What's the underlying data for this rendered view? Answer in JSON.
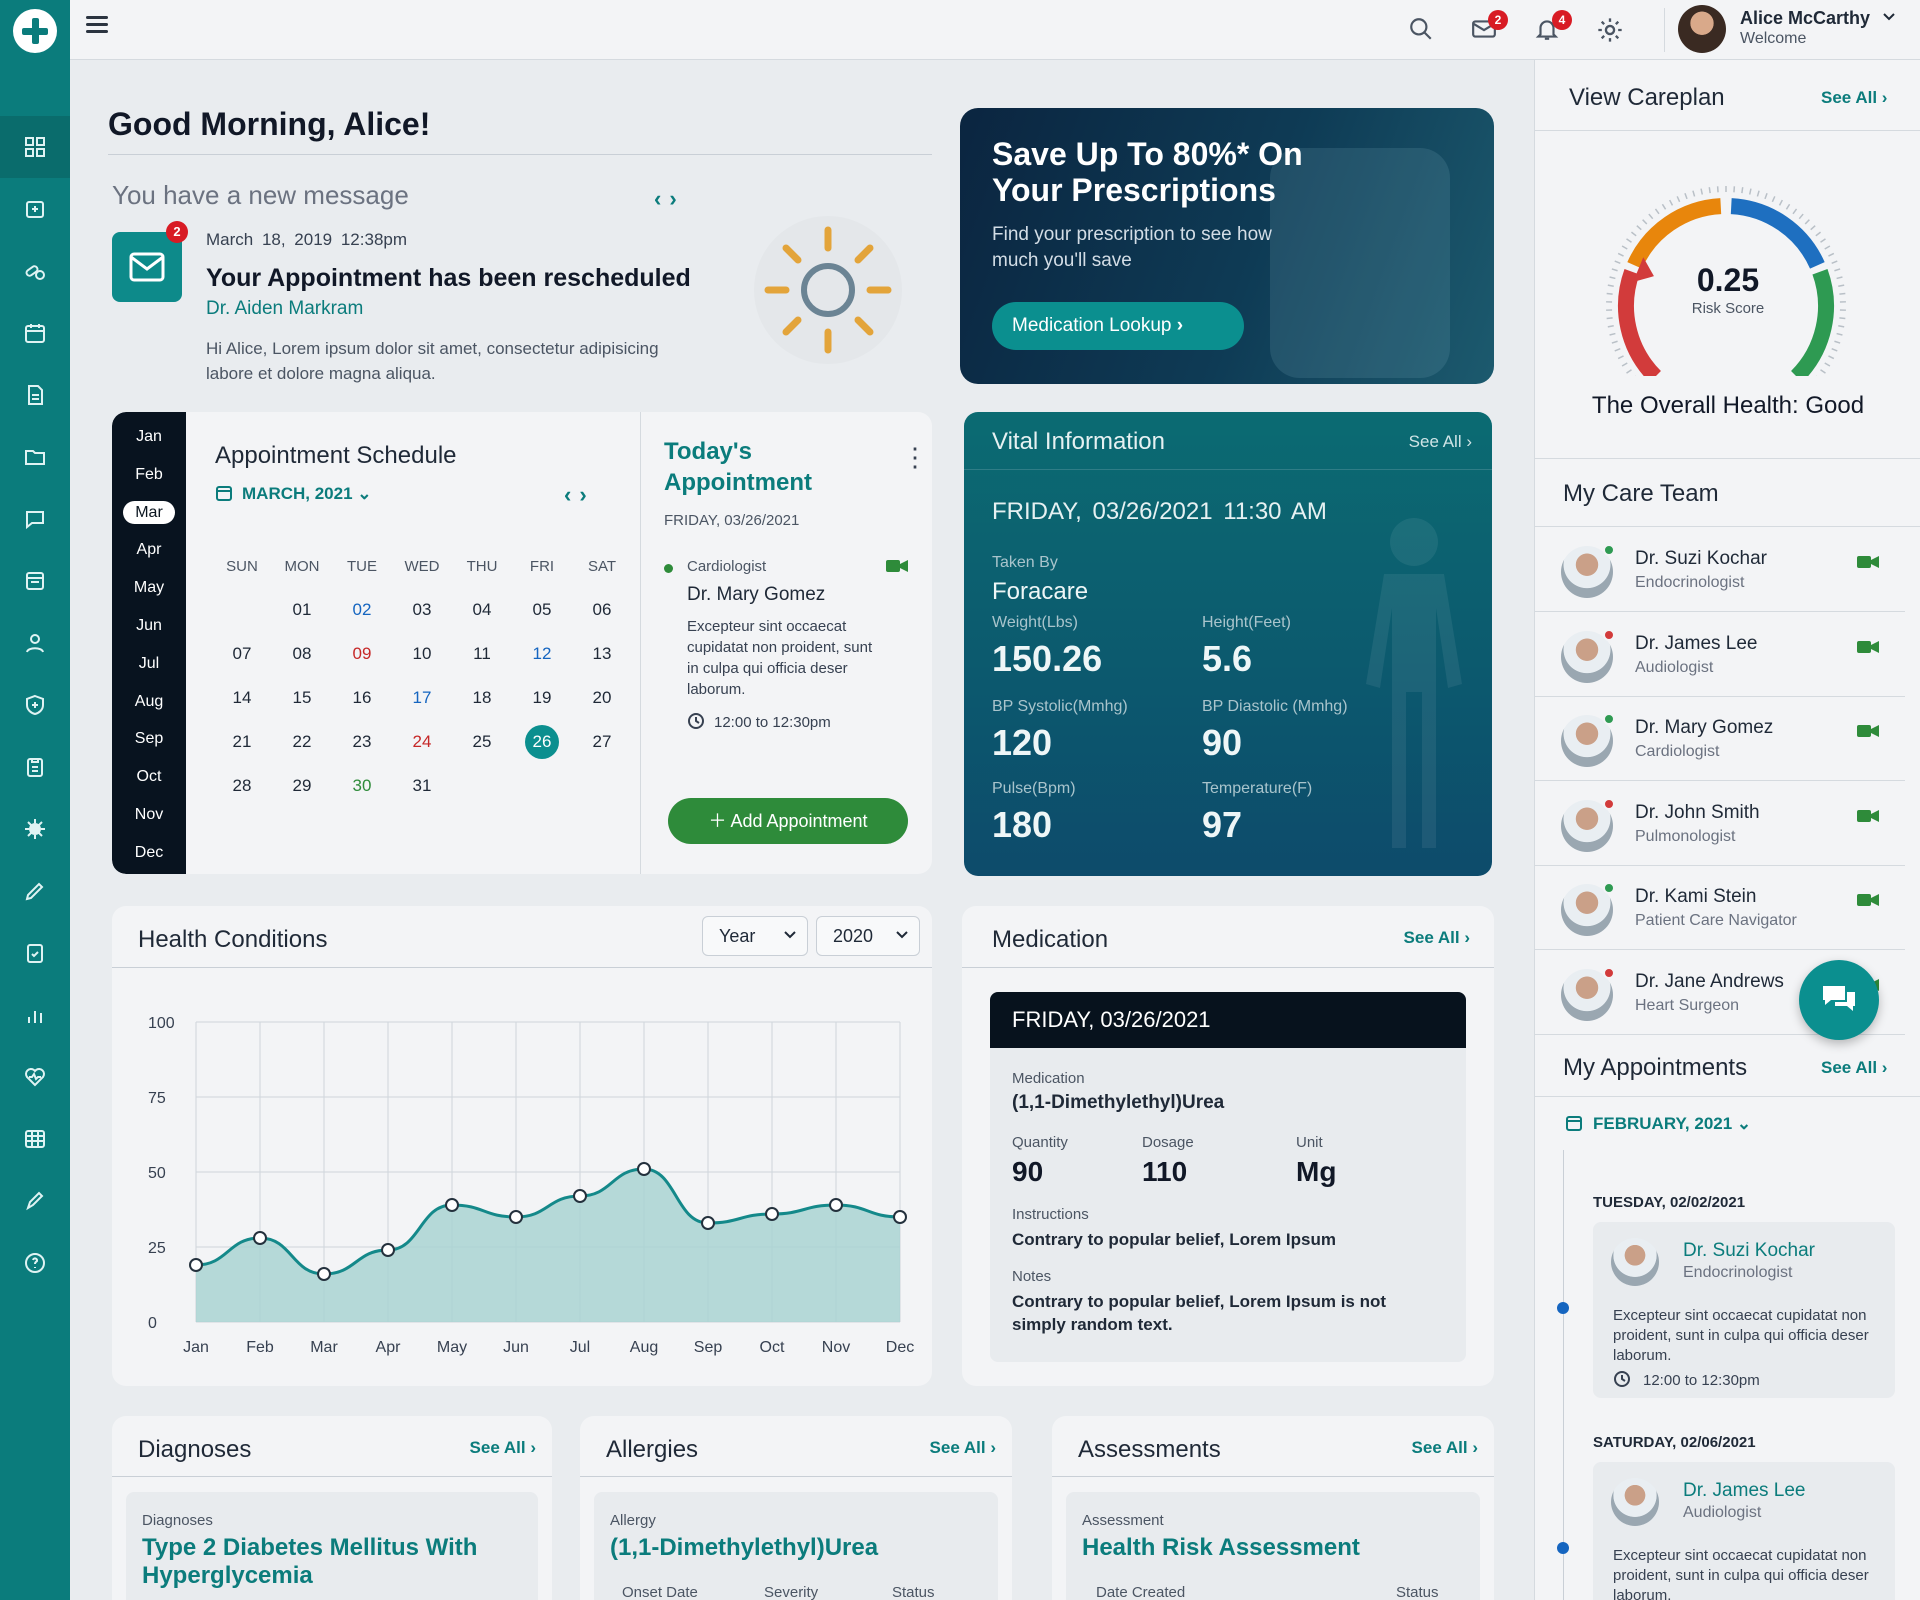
{
  "header": {
    "user_name": "Alice McCarthy",
    "user_sub": "Welcome",
    "mail_badge": "2",
    "bell_badge": "4"
  },
  "greeting": {
    "title": "Good Morning, Alice!",
    "new_message": "You have a new message",
    "msg_badge": "2",
    "msg_date": "March 18, 2019 12:38pm",
    "msg_title": "Your Appointment has been rescheduled",
    "msg_from": "Dr. Aiden Markram",
    "msg_body": "Hi Alice, Lorem ipsum dolor sit amet, consectetur adipisicing labore et dolore magna aliqua."
  },
  "promo": {
    "title": "Save Up To 80%* On Your Prescriptions",
    "subtitle": "Find your prescription to see how much you'll save",
    "button": "Medication Lookup"
  },
  "schedule": {
    "months": [
      "Jan",
      "Feb",
      "Mar",
      "Apr",
      "May",
      "Jun",
      "Jul",
      "Aug",
      "Sep",
      "Oct",
      "Nov",
      "Dec"
    ],
    "active_month_index": 2,
    "title": "Appointment Schedule",
    "month_label": "MARCH, 2021",
    "weekdays": [
      "SUN",
      "MON",
      "TUE",
      "WED",
      "THU",
      "FRI",
      "SAT"
    ],
    "weeks": [
      [
        {
          "d": ""
        },
        {
          "d": "01"
        },
        {
          "d": "02",
          "c": "blue"
        },
        {
          "d": "03"
        },
        {
          "d": "04"
        },
        {
          "d": "05"
        },
        {
          "d": "06"
        }
      ],
      [
        {
          "d": "07"
        },
        {
          "d": "08"
        },
        {
          "d": "09",
          "c": "red"
        },
        {
          "d": "10"
        },
        {
          "d": "11"
        },
        {
          "d": "12",
          "c": "blue"
        },
        {
          "d": "13"
        }
      ],
      [
        {
          "d": "14"
        },
        {
          "d": "15"
        },
        {
          "d": "16"
        },
        {
          "d": "17",
          "c": "blue"
        },
        {
          "d": "18"
        },
        {
          "d": "19"
        },
        {
          "d": "20"
        }
      ],
      [
        {
          "d": "21"
        },
        {
          "d": "22"
        },
        {
          "d": "23"
        },
        {
          "d": "24",
          "c": "red"
        },
        {
          "d": "25"
        },
        {
          "d": "26",
          "c": "today"
        },
        {
          "d": "27"
        }
      ],
      [
        {
          "d": "28"
        },
        {
          "d": "29"
        },
        {
          "d": "30",
          "c": "green"
        },
        {
          "d": "31"
        },
        {
          "d": ""
        },
        {
          "d": ""
        },
        {
          "d": ""
        }
      ]
    ]
  },
  "today": {
    "title": "Today's Appointment",
    "date": "FRIDAY, 03/26/2021",
    "specialty": "Cardiologist",
    "doctor": "Dr. Mary Gomez",
    "description": "Excepteur sint occaecat cupidatat non proident, sunt in culpa qui officia deser laborum.",
    "time": "12:00 to 12:30pm",
    "add_button": "Add Appointment"
  },
  "vital": {
    "title": "Vital Information",
    "see_all": "See All",
    "date": "FRIDAY, 03/26/2021 11:30 AM",
    "taken_by_label": "Taken By",
    "taken_by": "Foracare",
    "weight_label": "Weight(Lbs)",
    "weight": "150.26",
    "height_label": "Height(Feet)",
    "height": "5.6",
    "bps_label": "BP Systolic(Mmhg)",
    "bps": "120",
    "bpd_label": "BP Diastolic (Mmhg)",
    "bpd": "90",
    "pulse_label": "Pulse(Bpm)",
    "pulse": "180",
    "temp_label": "Temperature(F)",
    "temp": "97"
  },
  "health_conditions": {
    "title": "Health Conditions",
    "period_select": "Year",
    "year_select": "2020"
  },
  "chart_data": {
    "type": "area",
    "categories": [
      "Jan",
      "Feb",
      "Mar",
      "Apr",
      "May",
      "Jun",
      "Jul",
      "Aug",
      "Sep",
      "Oct",
      "Nov",
      "Dec"
    ],
    "yticks": [
      0,
      25,
      50,
      75,
      100
    ],
    "ylim": [
      0,
      100
    ],
    "grid": true,
    "series": [
      {
        "values": [
          19,
          28,
          16,
          24,
          39,
          35,
          42,
          51,
          33,
          36,
          39,
          35
        ]
      }
    ]
  },
  "medication": {
    "title": "Medication",
    "see_all": "See All",
    "date": "FRIDAY, 03/26/2021",
    "med_label": "Medication",
    "med": "(1,1-Dimethylethyl)Urea",
    "qty_label": "Quantity",
    "qty": "90",
    "dose_label": "Dosage",
    "dose": "110",
    "unit_label": "Unit",
    "unit": "Mg",
    "instr_label": "Instructions",
    "instr": "Contrary to popular belief, Lorem Ipsum",
    "notes_label": "Notes",
    "notes": "Contrary to popular belief, Lorem Ipsum is not simply random text."
  },
  "diagnoses": {
    "title": "Diagnoses",
    "see_all": "See All",
    "label": "Diagnoses",
    "value": "Type 2 Diabetes Mellitus With Hyperglycemia"
  },
  "allergies": {
    "title": "Allergies",
    "see_all": "See All",
    "label": "Allergy",
    "value": "(1,1-Dimethylethyl)Urea",
    "col1": "Onset Date",
    "col2": "Severity",
    "col3": "Status"
  },
  "assessments": {
    "title": "Assessments",
    "see_all": "See All",
    "label": "Assessment",
    "value": "Health Risk Assessment",
    "col1": "Date Created",
    "col2": "Status"
  },
  "careplan": {
    "title": "View Careplan",
    "see_all": "See All",
    "risk_value": 0.25,
    "risk_text": "0.25",
    "risk_label": "Risk Score",
    "overall": "The Overall Health: Good",
    "colors": {
      "red": "#d23b3b",
      "orange": "#e8860c",
      "blue": "#1e6fc0",
      "green": "#2e9a52"
    }
  },
  "care_team": {
    "title": "My Care Team",
    "members": [
      {
        "name": "Dr. Suzi Kochar",
        "role": "Endocrinologist",
        "status": "#2e9a52"
      },
      {
        "name": "Dr. James Lee",
        "role": "Audiologist",
        "status": "#d23b3b"
      },
      {
        "name": "Dr. Mary Gomez",
        "role": "Cardiologist",
        "status": "#2e9a52"
      },
      {
        "name": "Dr. John Smith",
        "role": "Pulmonologist",
        "status": "#d23b3b"
      },
      {
        "name": "Dr. Kami Stein",
        "role": "Patient Care Navigator",
        "status": "#2e9a52"
      },
      {
        "name": "Dr. Jane Andrews",
        "role": "Heart Surgeon",
        "status": "#d23b3b"
      }
    ]
  },
  "my_appointments": {
    "title": "My Appointments",
    "see_all": "See All",
    "month": "FEBRUARY, 2021",
    "items": [
      {
        "day": "TUESDAY, 02/02/2021",
        "name": "Dr. Suzi Kochar",
        "role": "Endocrinologist",
        "desc": "Excepteur sint occaecat cupidatat non proident, sunt in culpa qui officia deser laborum.",
        "time": "12:00 to 12:30pm"
      },
      {
        "day": "SATURDAY, 02/06/2021",
        "name": "Dr. James Lee",
        "role": "Audiologist",
        "desc": "Excepteur sint occaecat cupidatat non proident, sunt in culpa qui officia deser laborum."
      }
    ]
  }
}
